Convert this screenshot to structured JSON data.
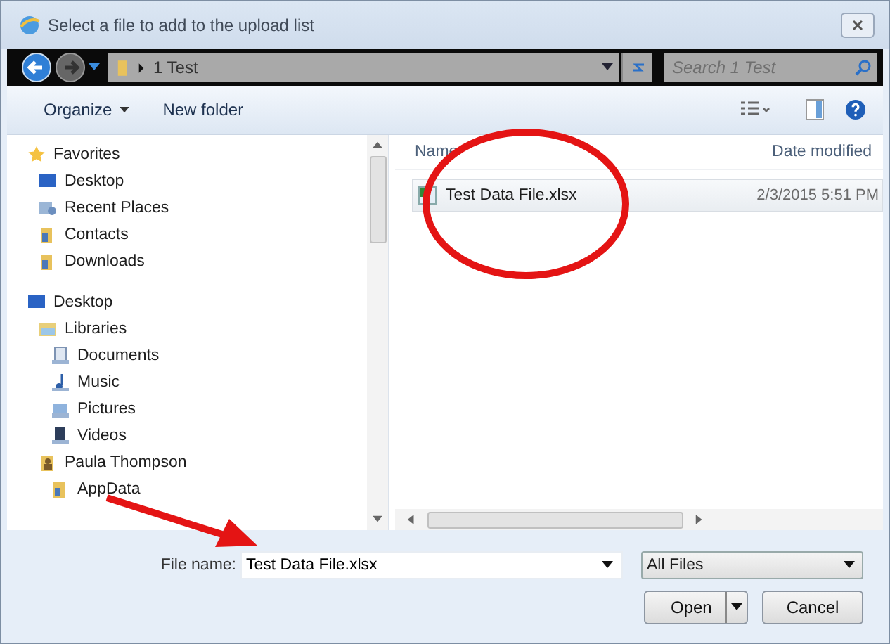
{
  "window": {
    "title": "Select a file to add to the upload list"
  },
  "address_bar": {
    "path": "1 Test"
  },
  "search": {
    "placeholder": "Search 1 Test"
  },
  "toolbar": {
    "organize": "Organize",
    "new_folder": "New folder"
  },
  "nav": [
    {
      "label": "Favorites",
      "kind": "star",
      "children": [
        {
          "label": "Desktop",
          "kind": "monitor"
        },
        {
          "label": "Recent Places",
          "kind": "places"
        },
        {
          "label": "Contacts",
          "kind": "folder"
        },
        {
          "label": "Downloads",
          "kind": "folder"
        }
      ]
    },
    {
      "label": "Desktop",
      "kind": "monitor",
      "children": [
        {
          "label": "Libraries",
          "kind": "library",
          "children": [
            {
              "label": "Documents",
              "kind": "documents"
            },
            {
              "label": "Music",
              "kind": "music"
            },
            {
              "label": "Pictures",
              "kind": "pictures"
            },
            {
              "label": "Videos",
              "kind": "videos"
            }
          ]
        },
        {
          "label": "Paula Thompson",
          "kind": "user",
          "children": [
            {
              "label": "AppData",
              "kind": "folder"
            }
          ]
        }
      ]
    }
  ],
  "columns": [
    "Name",
    "Date modified"
  ],
  "files": [
    {
      "name": "Test Data File.xlsx",
      "date_modified": "2/3/2015 5:51 PM"
    }
  ],
  "file_name": {
    "label": "File name:",
    "value": "Test Data File.xlsx"
  },
  "file_type": {
    "value": "All Files"
  },
  "buttons": {
    "open": "Open",
    "cancel": "Cancel"
  }
}
